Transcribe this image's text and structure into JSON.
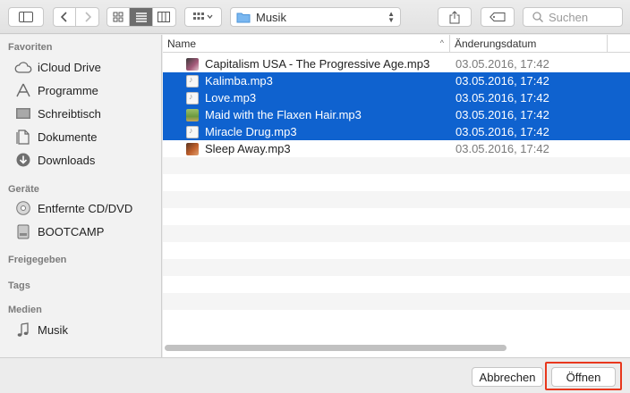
{
  "toolbar": {
    "path_label": "Musik",
    "search_placeholder": "Suchen",
    "view_mode": "list"
  },
  "sidebar": {
    "sections": [
      {
        "title": "Favoriten",
        "items": [
          {
            "label": "iCloud Drive",
            "icon": "cloud-icon"
          },
          {
            "label": "Programme",
            "icon": "apps-icon"
          },
          {
            "label": "Schreibtisch",
            "icon": "desktop-icon"
          },
          {
            "label": "Dokumente",
            "icon": "document-icon"
          },
          {
            "label": "Downloads",
            "icon": "download-icon"
          }
        ]
      },
      {
        "title": "Geräte",
        "items": [
          {
            "label": "Entfernte CD/DVD",
            "icon": "disc-icon"
          },
          {
            "label": "BOOTCAMP",
            "icon": "drive-icon"
          }
        ]
      },
      {
        "title": "Freigegeben",
        "items": []
      },
      {
        "title": "Tags",
        "items": []
      },
      {
        "title": "Medien",
        "items": [
          {
            "label": "Musik",
            "icon": "music-note-icon"
          }
        ]
      }
    ]
  },
  "list": {
    "columns": {
      "name": "Name",
      "date": "Änderungsdatum"
    },
    "files": [
      {
        "name": "Capitalism USA - The Progressive Age.mp3",
        "date": "03.05.2016, 17:42",
        "selected": false,
        "thumb": "album-art"
      },
      {
        "name": "Kalimba.mp3",
        "date": "03.05.2016, 17:42",
        "selected": true,
        "thumb": "audio-file"
      },
      {
        "name": "Love.mp3",
        "date": "03.05.2016, 17:42",
        "selected": true,
        "thumb": "audio-file"
      },
      {
        "name": "Maid with the Flaxen Hair.mp3",
        "date": "03.05.2016, 17:42",
        "selected": true,
        "thumb": "album-art"
      },
      {
        "name": "Miracle Drug.mp3",
        "date": "03.05.2016, 17:42",
        "selected": true,
        "thumb": "audio-file"
      },
      {
        "name": "Sleep Away.mp3",
        "date": "03.05.2016, 17:42",
        "selected": false,
        "thumb": "album-art"
      }
    ]
  },
  "footer": {
    "cancel_label": "Abbrechen",
    "open_label": "Öffnen"
  },
  "colors": {
    "selection": "#0f62cf",
    "highlight_outline": "#e8371d"
  }
}
